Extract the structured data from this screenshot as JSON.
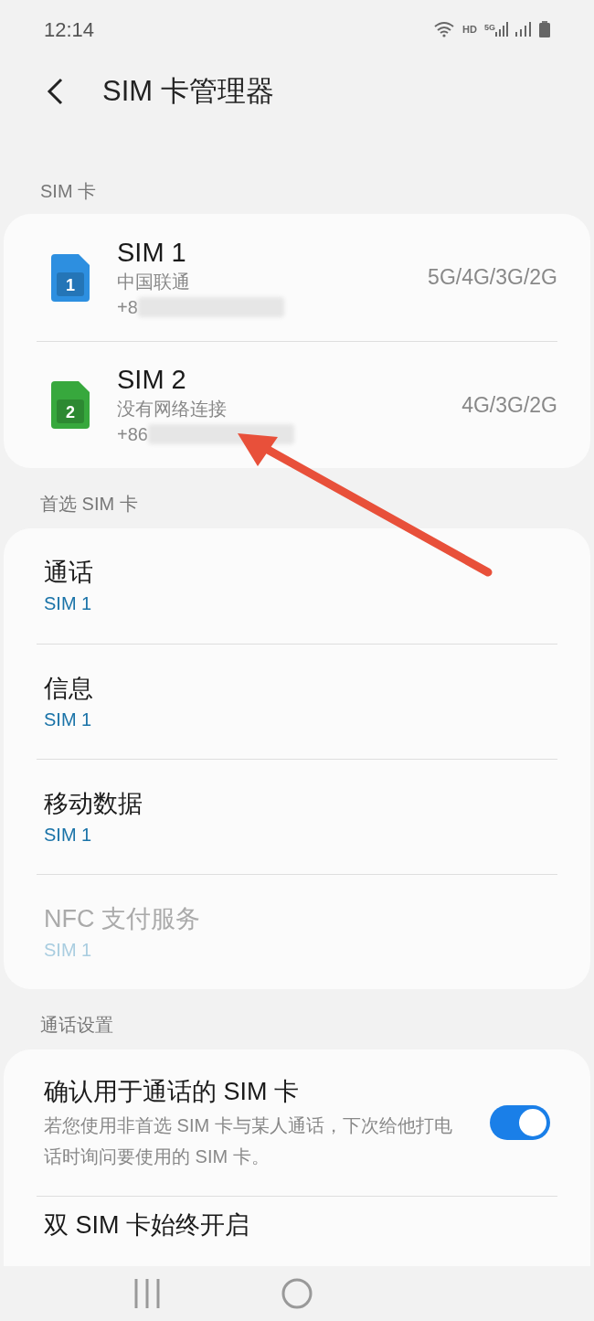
{
  "status_bar": {
    "time": "12:14",
    "network_label": "HD",
    "network_type": "5G"
  },
  "header": {
    "title": "SIM 卡管理器"
  },
  "sim_section": {
    "label": "SIM 卡",
    "cards": [
      {
        "name": "SIM 1",
        "slot": "1",
        "color": "#2d8fe0",
        "carrier": "中国联通",
        "number": "+8",
        "networks": "5G/4G/3G/2G"
      },
      {
        "name": "SIM 2",
        "slot": "2",
        "color": "#37a83d",
        "carrier": "没有网络连接",
        "number": "+86",
        "networks": "4G/3G/2G"
      }
    ]
  },
  "preferred_section": {
    "label": "首选 SIM 卡",
    "items": [
      {
        "title": "通话",
        "value": "SIM 1",
        "disabled": false
      },
      {
        "title": "信息",
        "value": "SIM 1",
        "disabled": false
      },
      {
        "title": "移动数据",
        "value": "SIM 1",
        "disabled": false
      },
      {
        "title": "NFC 支付服务",
        "value": "SIM 1",
        "disabled": true
      }
    ]
  },
  "call_settings": {
    "label": "通话设置",
    "items": [
      {
        "kind": "toggle",
        "title": "确认用于通话的 SIM 卡",
        "description": "若您使用非首选 SIM 卡与某人通话，下次给他打电话时询问要使用的 SIM 卡。",
        "on": true
      },
      {
        "kind": "plain",
        "title": "双 SIM 卡始终开启"
      }
    ]
  }
}
